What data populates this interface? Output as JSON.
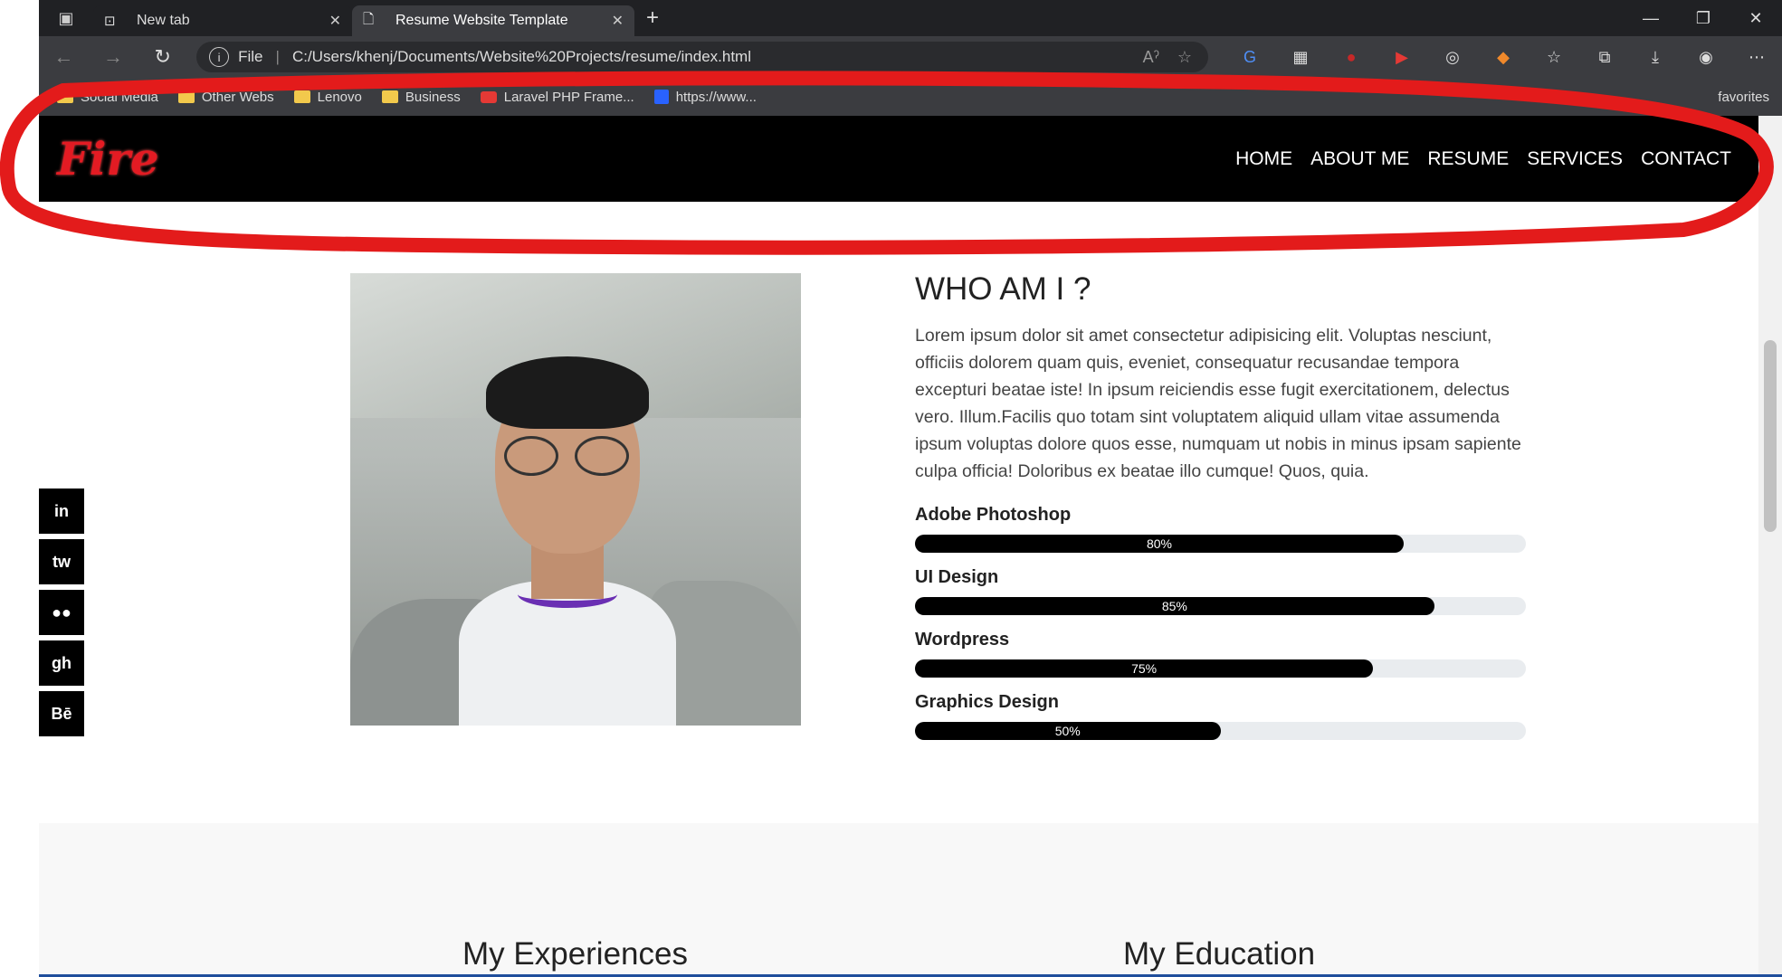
{
  "browser": {
    "tabs": [
      {
        "label": "New tab",
        "active": false
      },
      {
        "label": "Resume Website Template",
        "active": true
      }
    ],
    "address": {
      "scheme": "File",
      "url": "C:/Users/khenj/Documents/Website%20Projects/resume/index.html"
    },
    "bookmarks": [
      "Social Media",
      "Other Webs",
      "Lenovo",
      "Business",
      "Laravel PHP Frame...",
      "https://www...",
      "favorites"
    ]
  },
  "site": {
    "logo_text": "Fire",
    "nav": [
      "HOME",
      "ABOUT ME",
      "RESUME",
      "SERVICES",
      "CONTACT"
    ],
    "social": [
      "in",
      "tw",
      "●●",
      "gh",
      "Bē"
    ],
    "about": {
      "title": "WHO AM I ?",
      "body": "Lorem ipsum dolor sit amet consectetur adipisicing elit. Voluptas nesciunt, officiis dolorem quam quis, eveniet, consequatur recusandae tempora excepturi beatae iste! In ipsum reiciendis esse fugit exercitationem, delectus vero. Illum.Facilis quo totam sint voluptatem aliquid ullam vitae assumenda ipsum voluptas dolore quos esse, numquam ut nobis in minus ipsam sapiente culpa officia! Doloribus ex beatae illo cumque! Quos, quia."
    },
    "skills": [
      {
        "name": "Adobe Photoshop",
        "percent": 80,
        "label": "80%"
      },
      {
        "name": "UI Design",
        "percent": 85,
        "label": "85%"
      },
      {
        "name": "Wordpress",
        "percent": 75,
        "label": "75%"
      },
      {
        "name": "Graphics Design",
        "percent": 50,
        "label": "50%"
      }
    ],
    "sections": {
      "experiences": "My Experiences",
      "education": "My Education"
    }
  },
  "colors": {
    "annotation": "#e31b1b",
    "nav_bg": "#000000",
    "bar_fill": "#000000",
    "bar_track": "#e9ecef"
  }
}
